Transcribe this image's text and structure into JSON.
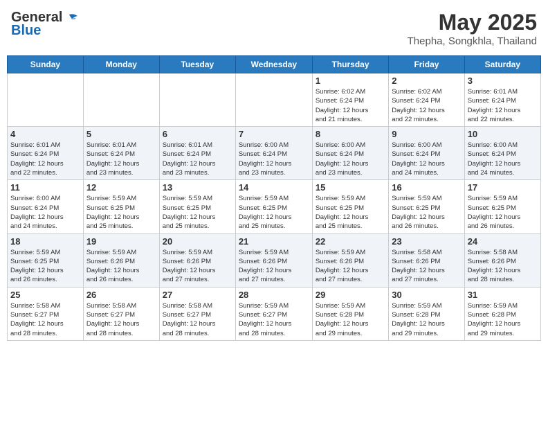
{
  "logo": {
    "line1": "General",
    "line2": "Blue"
  },
  "title": "May 2025",
  "subtitle": "Thepha, Songkhla, Thailand",
  "days_of_week": [
    "Sunday",
    "Monday",
    "Tuesday",
    "Wednesday",
    "Thursday",
    "Friday",
    "Saturday"
  ],
  "weeks": [
    [
      {
        "day": "",
        "info": ""
      },
      {
        "day": "",
        "info": ""
      },
      {
        "day": "",
        "info": ""
      },
      {
        "day": "",
        "info": ""
      },
      {
        "day": "1",
        "info": "Sunrise: 6:02 AM\nSunset: 6:24 PM\nDaylight: 12 hours\nand 21 minutes."
      },
      {
        "day": "2",
        "info": "Sunrise: 6:02 AM\nSunset: 6:24 PM\nDaylight: 12 hours\nand 22 minutes."
      },
      {
        "day": "3",
        "info": "Sunrise: 6:01 AM\nSunset: 6:24 PM\nDaylight: 12 hours\nand 22 minutes."
      }
    ],
    [
      {
        "day": "4",
        "info": "Sunrise: 6:01 AM\nSunset: 6:24 PM\nDaylight: 12 hours\nand 22 minutes."
      },
      {
        "day": "5",
        "info": "Sunrise: 6:01 AM\nSunset: 6:24 PM\nDaylight: 12 hours\nand 23 minutes."
      },
      {
        "day": "6",
        "info": "Sunrise: 6:01 AM\nSunset: 6:24 PM\nDaylight: 12 hours\nand 23 minutes."
      },
      {
        "day": "7",
        "info": "Sunrise: 6:00 AM\nSunset: 6:24 PM\nDaylight: 12 hours\nand 23 minutes."
      },
      {
        "day": "8",
        "info": "Sunrise: 6:00 AM\nSunset: 6:24 PM\nDaylight: 12 hours\nand 23 minutes."
      },
      {
        "day": "9",
        "info": "Sunrise: 6:00 AM\nSunset: 6:24 PM\nDaylight: 12 hours\nand 24 minutes."
      },
      {
        "day": "10",
        "info": "Sunrise: 6:00 AM\nSunset: 6:24 PM\nDaylight: 12 hours\nand 24 minutes."
      }
    ],
    [
      {
        "day": "11",
        "info": "Sunrise: 6:00 AM\nSunset: 6:24 PM\nDaylight: 12 hours\nand 24 minutes."
      },
      {
        "day": "12",
        "info": "Sunrise: 5:59 AM\nSunset: 6:25 PM\nDaylight: 12 hours\nand 25 minutes."
      },
      {
        "day": "13",
        "info": "Sunrise: 5:59 AM\nSunset: 6:25 PM\nDaylight: 12 hours\nand 25 minutes."
      },
      {
        "day": "14",
        "info": "Sunrise: 5:59 AM\nSunset: 6:25 PM\nDaylight: 12 hours\nand 25 minutes."
      },
      {
        "day": "15",
        "info": "Sunrise: 5:59 AM\nSunset: 6:25 PM\nDaylight: 12 hours\nand 25 minutes."
      },
      {
        "day": "16",
        "info": "Sunrise: 5:59 AM\nSunset: 6:25 PM\nDaylight: 12 hours\nand 26 minutes."
      },
      {
        "day": "17",
        "info": "Sunrise: 5:59 AM\nSunset: 6:25 PM\nDaylight: 12 hours\nand 26 minutes."
      }
    ],
    [
      {
        "day": "18",
        "info": "Sunrise: 5:59 AM\nSunset: 6:25 PM\nDaylight: 12 hours\nand 26 minutes."
      },
      {
        "day": "19",
        "info": "Sunrise: 5:59 AM\nSunset: 6:26 PM\nDaylight: 12 hours\nand 26 minutes."
      },
      {
        "day": "20",
        "info": "Sunrise: 5:59 AM\nSunset: 6:26 PM\nDaylight: 12 hours\nand 27 minutes."
      },
      {
        "day": "21",
        "info": "Sunrise: 5:59 AM\nSunset: 6:26 PM\nDaylight: 12 hours\nand 27 minutes."
      },
      {
        "day": "22",
        "info": "Sunrise: 5:59 AM\nSunset: 6:26 PM\nDaylight: 12 hours\nand 27 minutes."
      },
      {
        "day": "23",
        "info": "Sunrise: 5:58 AM\nSunset: 6:26 PM\nDaylight: 12 hours\nand 27 minutes."
      },
      {
        "day": "24",
        "info": "Sunrise: 5:58 AM\nSunset: 6:26 PM\nDaylight: 12 hours\nand 28 minutes."
      }
    ],
    [
      {
        "day": "25",
        "info": "Sunrise: 5:58 AM\nSunset: 6:27 PM\nDaylight: 12 hours\nand 28 minutes."
      },
      {
        "day": "26",
        "info": "Sunrise: 5:58 AM\nSunset: 6:27 PM\nDaylight: 12 hours\nand 28 minutes."
      },
      {
        "day": "27",
        "info": "Sunrise: 5:58 AM\nSunset: 6:27 PM\nDaylight: 12 hours\nand 28 minutes."
      },
      {
        "day": "28",
        "info": "Sunrise: 5:59 AM\nSunset: 6:27 PM\nDaylight: 12 hours\nand 28 minutes."
      },
      {
        "day": "29",
        "info": "Sunrise: 5:59 AM\nSunset: 6:28 PM\nDaylight: 12 hours\nand 29 minutes."
      },
      {
        "day": "30",
        "info": "Sunrise: 5:59 AM\nSunset: 6:28 PM\nDaylight: 12 hours\nand 29 minutes."
      },
      {
        "day": "31",
        "info": "Sunrise: 5:59 AM\nSunset: 6:28 PM\nDaylight: 12 hours\nand 29 minutes."
      }
    ]
  ]
}
